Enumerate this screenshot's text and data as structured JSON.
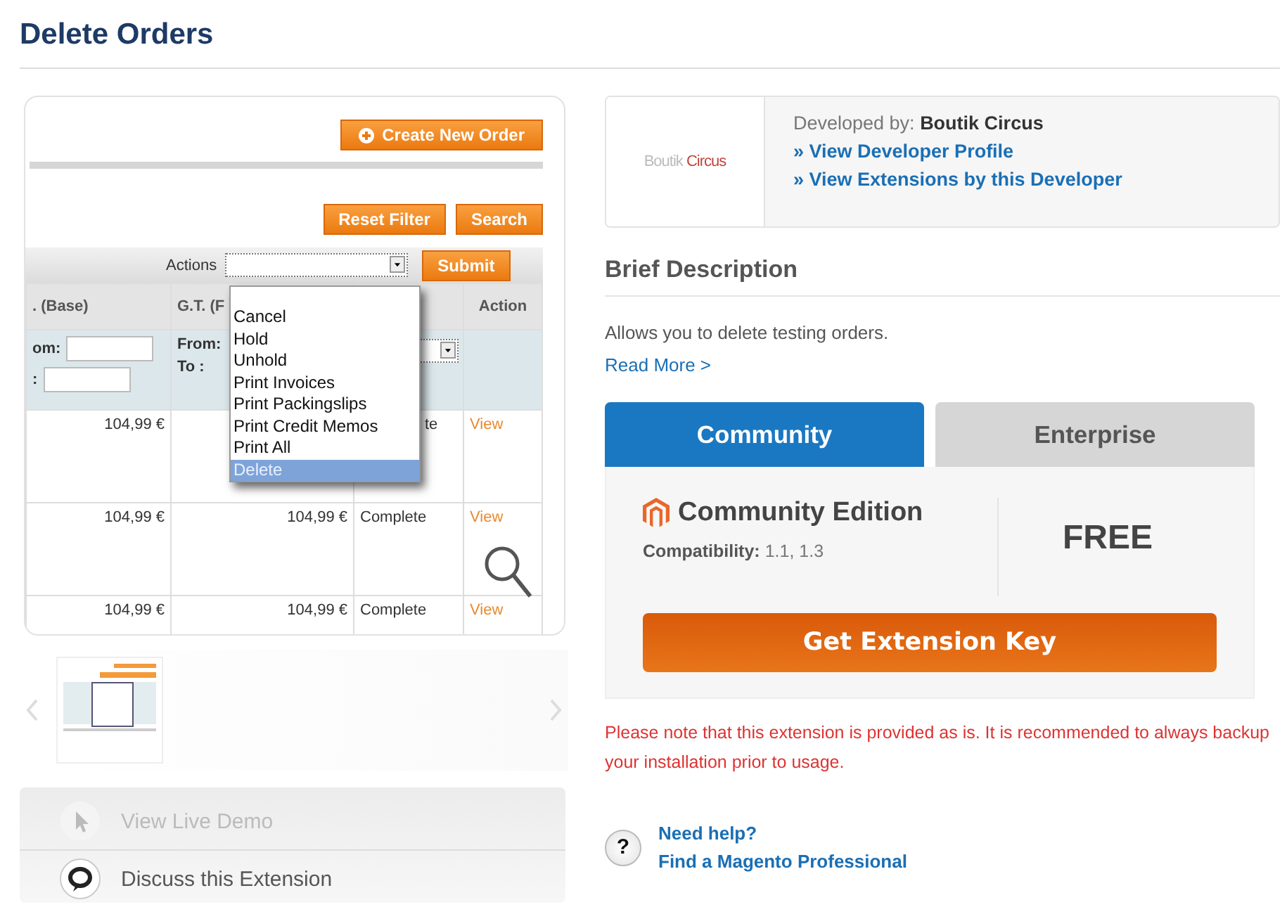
{
  "page_title": "Delete Orders",
  "screenshot": {
    "create_button": "Create New Order",
    "reset_button": "Reset Filter",
    "search_button": "Search",
    "actions_label": "Actions",
    "submit_button": "Submit",
    "columns": [
      ". (Base)",
      "G.T. (F",
      "Action"
    ],
    "filter": {
      "col1_labels": [
        "om:",
        ":"
      ],
      "col2_labels": [
        "From:",
        "To :"
      ]
    },
    "rows": [
      {
        "base": "104,99 €",
        "status": "te",
        "action": "View"
      },
      {
        "base": "104,99 €",
        "purchased": "104,99 €",
        "status": "Complete",
        "action": "View"
      },
      {
        "base": "104,99 €",
        "purchased": "104,99 €",
        "status": "Complete",
        "action": "View"
      }
    ],
    "action_options": [
      {
        "label": "Cancel",
        "selected": false
      },
      {
        "label": "Hold",
        "selected": false
      },
      {
        "label": "Unhold",
        "selected": false
      },
      {
        "label": "Print Invoices",
        "selected": false
      },
      {
        "label": "Print Packingslips",
        "selected": false
      },
      {
        "label": "Print Credit Memos",
        "selected": false
      },
      {
        "label": "Print All",
        "selected": false
      },
      {
        "label": "Delete",
        "selected": true
      }
    ]
  },
  "demo_links": [
    {
      "kind": "demo",
      "label": "View Live Demo",
      "disabled": true
    },
    {
      "kind": "discuss",
      "label": "Discuss this Extension",
      "disabled": false
    }
  ],
  "developer": {
    "logo": [
      "Boutik",
      "Circus"
    ],
    "developed_by": "Developed by: **Boutik Circus**",
    "links": [
      "» View Developer Profile",
      "» View Extensions by this Developer"
    ]
  },
  "description": {
    "heading": "Brief Description",
    "text": "Allows you to delete testing orders.",
    "read_more": "Read More >"
  },
  "edition_tabs": [
    {
      "label": "Community",
      "selected": true
    },
    {
      "label": "Enterprise",
      "selected": false
    }
  ],
  "edition": {
    "name": "Community Edition",
    "compatibility": "**Compatibility:** 1.1, 1.3",
    "price": "FREE",
    "button": "Get Extension Key"
  },
  "note": "Please note that this extension is provided as is. It is recommended to always backup your installation prior to usage.",
  "help": {
    "icon": "?",
    "title": "Need help?",
    "link": "Find a Magento Professional"
  }
}
